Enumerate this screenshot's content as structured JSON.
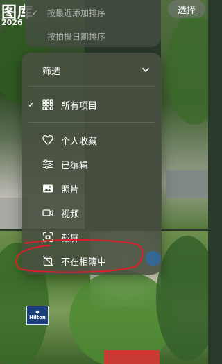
{
  "header": {
    "title": "图库",
    "year": "2026",
    "select_label": "选择"
  },
  "sort_menu": {
    "items": [
      {
        "label": "按最近添加排序",
        "checked": true
      },
      {
        "label": "按拍摄日期排序",
        "checked": false
      }
    ]
  },
  "filter_menu": {
    "title": "筛选",
    "items": [
      {
        "label": "所有项目",
        "icon": "grid-icon",
        "checked": true
      },
      {
        "label": "个人收藏",
        "icon": "heart-icon",
        "checked": false
      },
      {
        "label": "已编辑",
        "icon": "sliders-icon",
        "checked": false
      },
      {
        "label": "照片",
        "icon": "photo-icon",
        "checked": false
      },
      {
        "label": "视频",
        "icon": "video-icon",
        "checked": false
      },
      {
        "label": "截屏",
        "icon": "screenshot-icon",
        "checked": false
      },
      {
        "label": "不在相簿中",
        "icon": "not-in-album-icon",
        "checked": false
      }
    ]
  },
  "sign": {
    "text": "Hilton"
  },
  "colors": {
    "annotation": "#d6202a",
    "menu_bg": "#485040"
  }
}
